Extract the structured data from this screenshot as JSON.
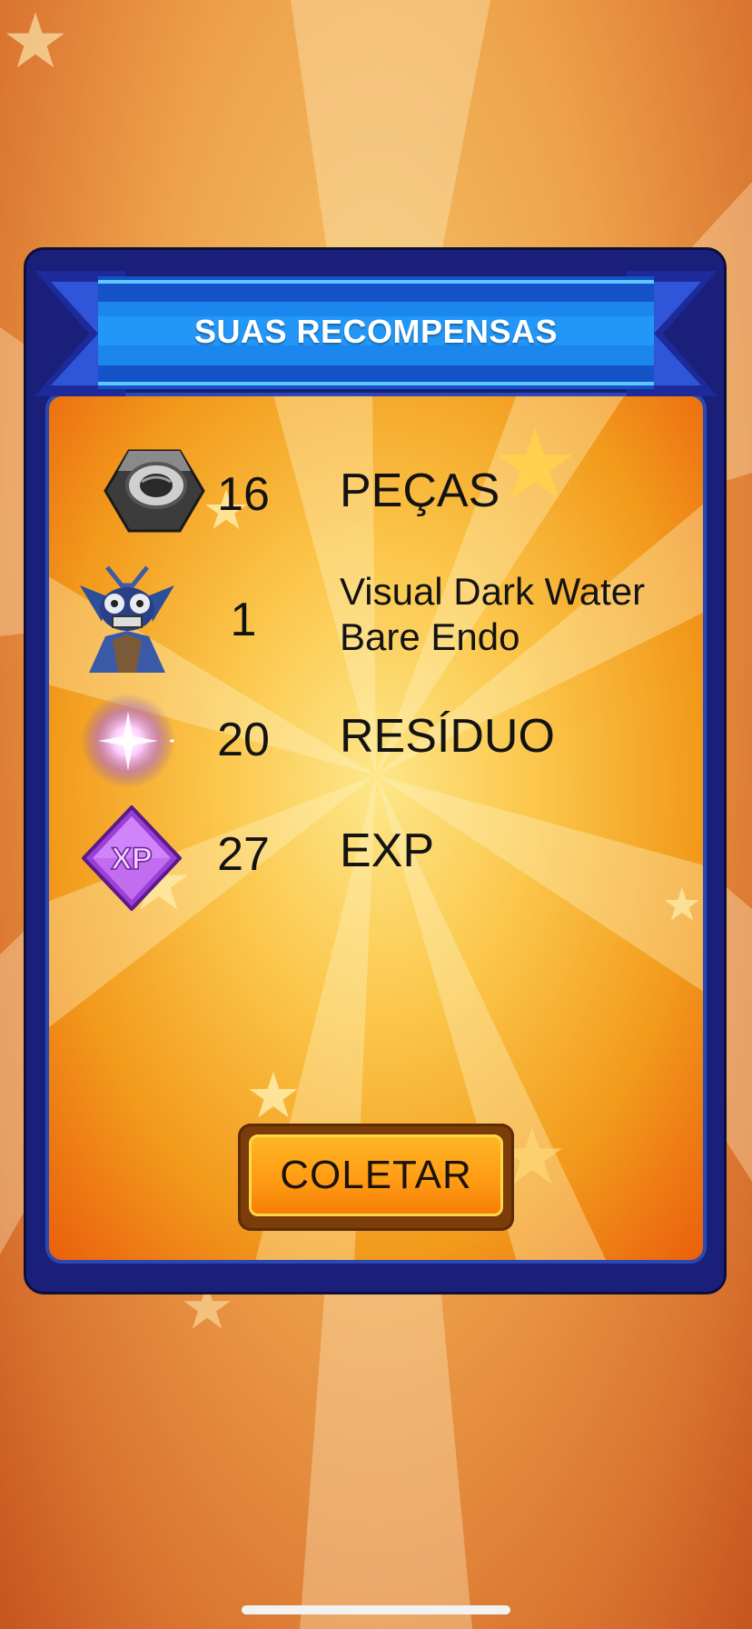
{
  "header": {
    "title": "SUAS RECOMPENSAS"
  },
  "rewards": [
    {
      "quantity": "16",
      "name": "PEÇAS",
      "icon": "hex-nut-icon"
    },
    {
      "quantity": "1",
      "name": "Visual Dark Water Bare Endo",
      "icon": "animatronic-endo-icon"
    },
    {
      "quantity": "20",
      "name": "RESÍDUO",
      "icon": "glowing-remnant-icon"
    },
    {
      "quantity": "27",
      "name": "EXP",
      "icon": "xp-gem-icon",
      "icon_text": "XP"
    }
  ],
  "collect_button": {
    "label": "COLETAR"
  },
  "colors": {
    "panel_border": "#1a1f7a",
    "ribbon": "#1e63d6",
    "button": "#ff9a12"
  }
}
